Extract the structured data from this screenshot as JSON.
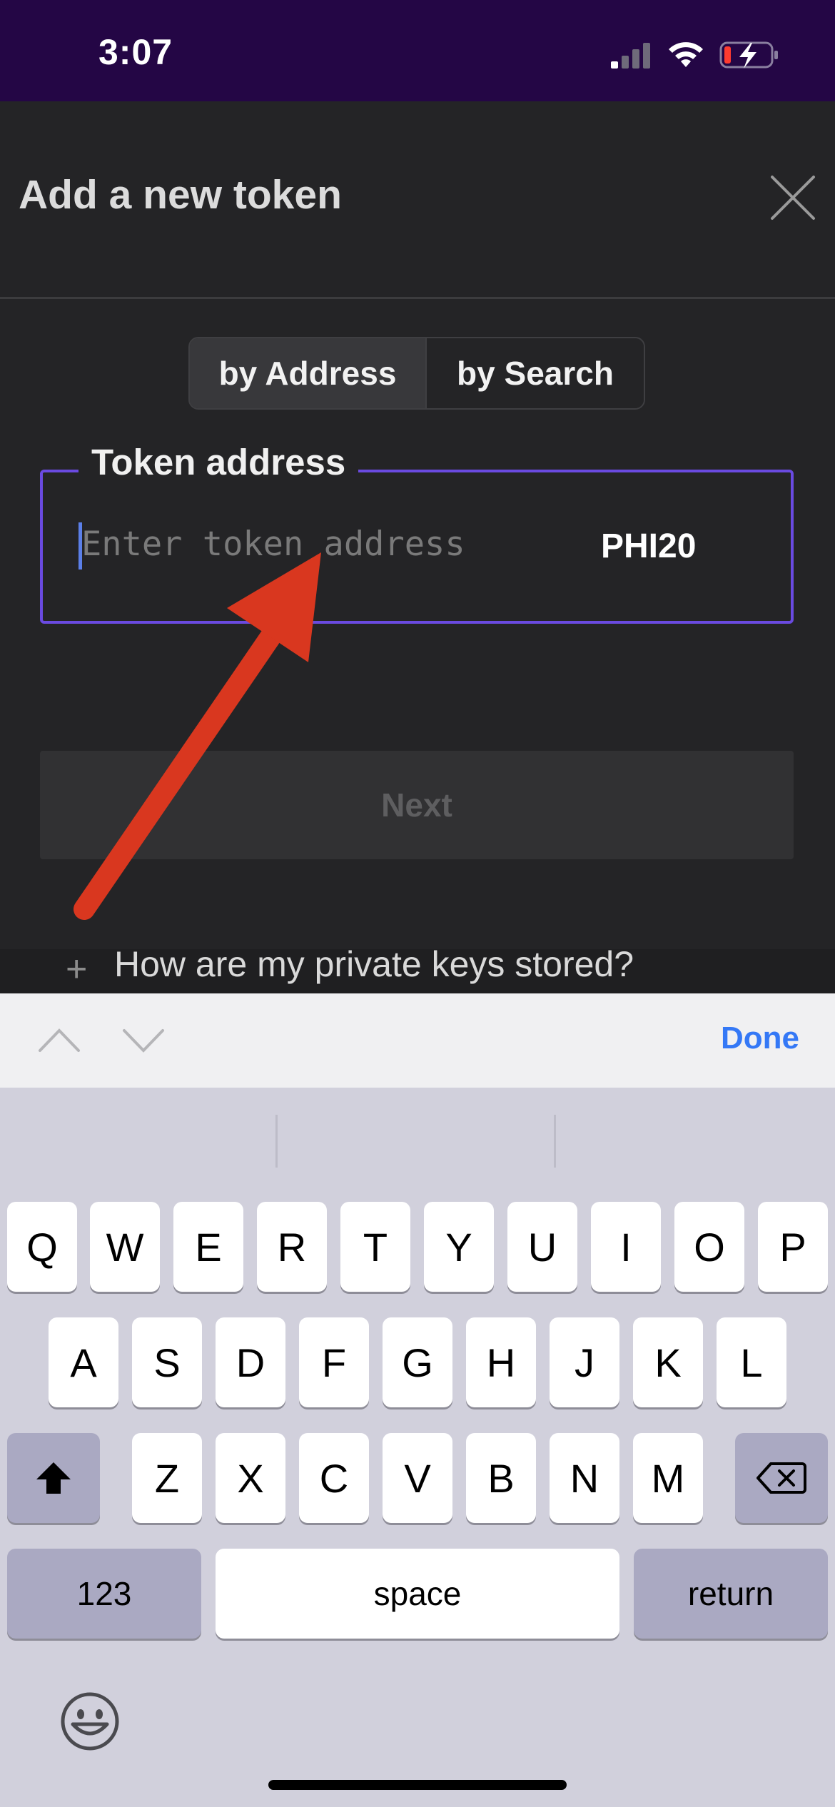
{
  "status_bar": {
    "time": "3:07"
  },
  "sheet": {
    "title": "Add a new token",
    "tabs": [
      "by Address",
      "by Search"
    ],
    "field_label": "Token address",
    "field_placeholder": "Enter token address",
    "field_suffix": "PHI20",
    "next_label": "Next"
  },
  "background": {
    "faq_item": "How are my private keys stored?"
  },
  "accessory": {
    "done_label": "Done"
  },
  "keyboard": {
    "row1": [
      "Q",
      "W",
      "E",
      "R",
      "T",
      "Y",
      "U",
      "I",
      "O",
      "P"
    ],
    "row2": [
      "A",
      "S",
      "D",
      "F",
      "G",
      "H",
      "J",
      "K",
      "L"
    ],
    "row3": [
      "Z",
      "X",
      "C",
      "V",
      "B",
      "N",
      "M"
    ],
    "numbers_label": "123",
    "space_label": "space",
    "return_label": "return"
  },
  "colors": {
    "accent": "#6a4ae0",
    "status_bar": "#240645",
    "annotation_arrow": "#d9371f"
  }
}
